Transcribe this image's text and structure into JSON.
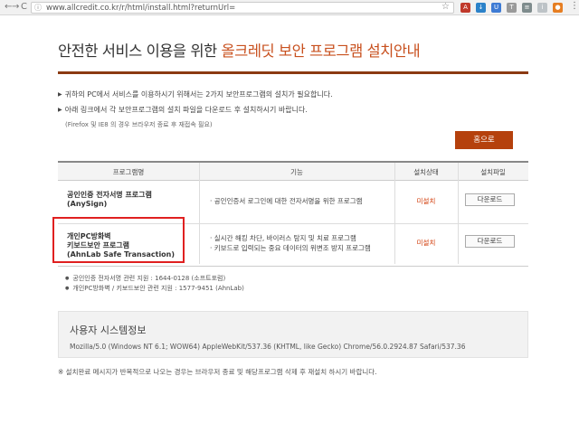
{
  "browser": {
    "back_glyph": "←",
    "forward_glyph": "→",
    "reload_glyph": "C",
    "info_glyph": "ⓘ",
    "url": "www.allcredit.co.kr/r/html/install.html?returnUrl=",
    "star_glyph": "☆",
    "menu_glyph": "⋮",
    "extensions": [
      {
        "name": "pdf-extension-icon",
        "glyph": "A",
        "color": "#c0392b"
      },
      {
        "name": "download-extension-icon",
        "glyph": "↓",
        "color": "#2c82c9"
      },
      {
        "name": "shield-extension-icon",
        "glyph": "U",
        "color": "#3e7bd4"
      },
      {
        "name": "t-extension-icon",
        "glyph": "T",
        "color": "#9a9a9a"
      },
      {
        "name": "doc-extension-icon",
        "glyph": "≡",
        "color": "#7f8c8d"
      },
      {
        "name": "info-extension-icon",
        "glyph": "i",
        "color": "#bdc3c7"
      },
      {
        "name": "puzzle-extension-icon",
        "glyph": "●",
        "color": "#e67e22"
      }
    ]
  },
  "page": {
    "title_prefix": "안전한 서비스 이용을 위한 ",
    "title_highlight": "올크레딧 보안 프로그램 설치안내",
    "bullet_1": "귀하의 PC에서 서비스를 이용하시기 위해서는 2가지 보안프로그램의 설치가 필요합니다.",
    "bullet_2": "아래 링크에서 각 보안프로그램의 설치 파일을 다운로드 후 설치하시기 바랍니다.",
    "bullet_note": "(Firefox 및 IE8 의 경우 브라우저 종료 후 재접속 필요)",
    "home_button": "홈으로"
  },
  "table": {
    "headers": [
      "프로그램명",
      "기능",
      "설치상태",
      "설치파일"
    ],
    "rows": [
      {
        "name_line1": "공인인증 전자서명 프로그램",
        "name_line2": "(AnySign)",
        "name_line3": "",
        "features": [
          "공인인증서 로그인에 대한 전자서명을 위한 프로그램"
        ],
        "status": "미설치",
        "download": "다운로드"
      },
      {
        "name_line1": "개인PC방화벽",
        "name_line2": "키보드보안 프로그램",
        "name_line3": "(AhnLab Safe Transaction)",
        "features": [
          "실시간 해킹 차단, 바이러스 탐지 및 치료 프로그램",
          "키보드로 입력되는 중요 데이터의 위변조 방지 프로그램"
        ],
        "status": "미설치",
        "download": "다운로드"
      }
    ]
  },
  "support": [
    "공인인증 전자서명 관련 지원 : 1644-0128 (소프트포럼)",
    "개인PC방화벽 / 키보드보안 관련 지원 : 1577-9451 (AhnLab)"
  ],
  "system_info": {
    "title": "사용자 시스템정보",
    "user_agent": "Mozilla/5.0 (Windows NT 6.1; WOW64) AppleWebKit/537.36 (KHTML, like Gecko) Chrome/56.0.2924.87 Safari/537.36"
  },
  "footer_note": "※ 설치완료 메시지가 반복적으로 나오는 경우는 브라우저 종료 및 해당프로그램 삭제 후 재설치 하시기 바랍니다.",
  "colors": {
    "accent": "#c8501e",
    "rule": "#8b3a12",
    "button": "#b5410d",
    "status": "#d23c0a",
    "highlight_box": "#e02020"
  }
}
